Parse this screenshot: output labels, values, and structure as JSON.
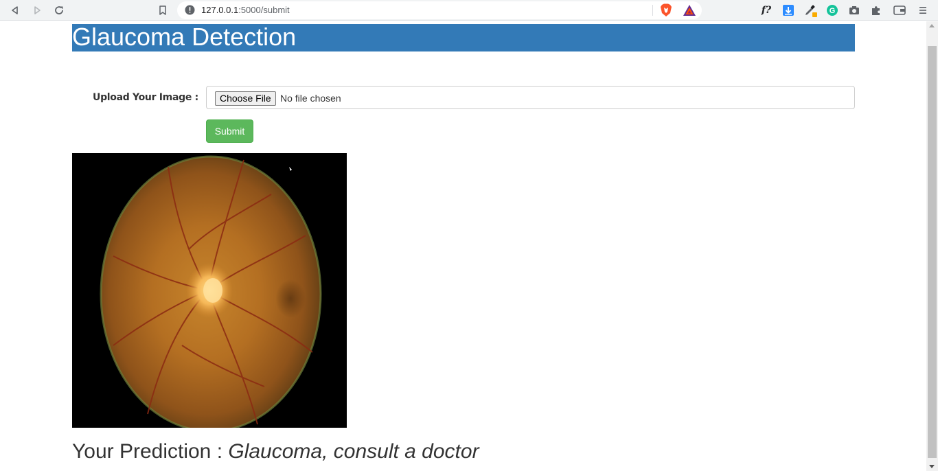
{
  "browser": {
    "url_host": "127.0.0.1",
    "url_path": ":5000/submit"
  },
  "page": {
    "title": "Glaucoma Detection",
    "upload_label": "Upload Your Image :",
    "choose_file_label": "Choose File",
    "no_file_text": "No file chosen",
    "submit_label": "Submit",
    "prediction_label": "Your Prediction :",
    "prediction_value": "Glaucoma, consult a doctor"
  },
  "colors": {
    "header_bg": "#337ab7",
    "submit_bg": "#5cb85c"
  },
  "icons": [
    "back-icon",
    "forward-icon",
    "reload-icon",
    "bookmark-icon",
    "info-icon",
    "brave-shield-icon",
    "bat-rewards-icon",
    "font-extension-icon",
    "download-extension-icon",
    "eyedropper-extension-icon",
    "grammarly-icon",
    "camera-icon",
    "extensions-puzzle-icon",
    "wallet-icon",
    "menu-icon"
  ]
}
